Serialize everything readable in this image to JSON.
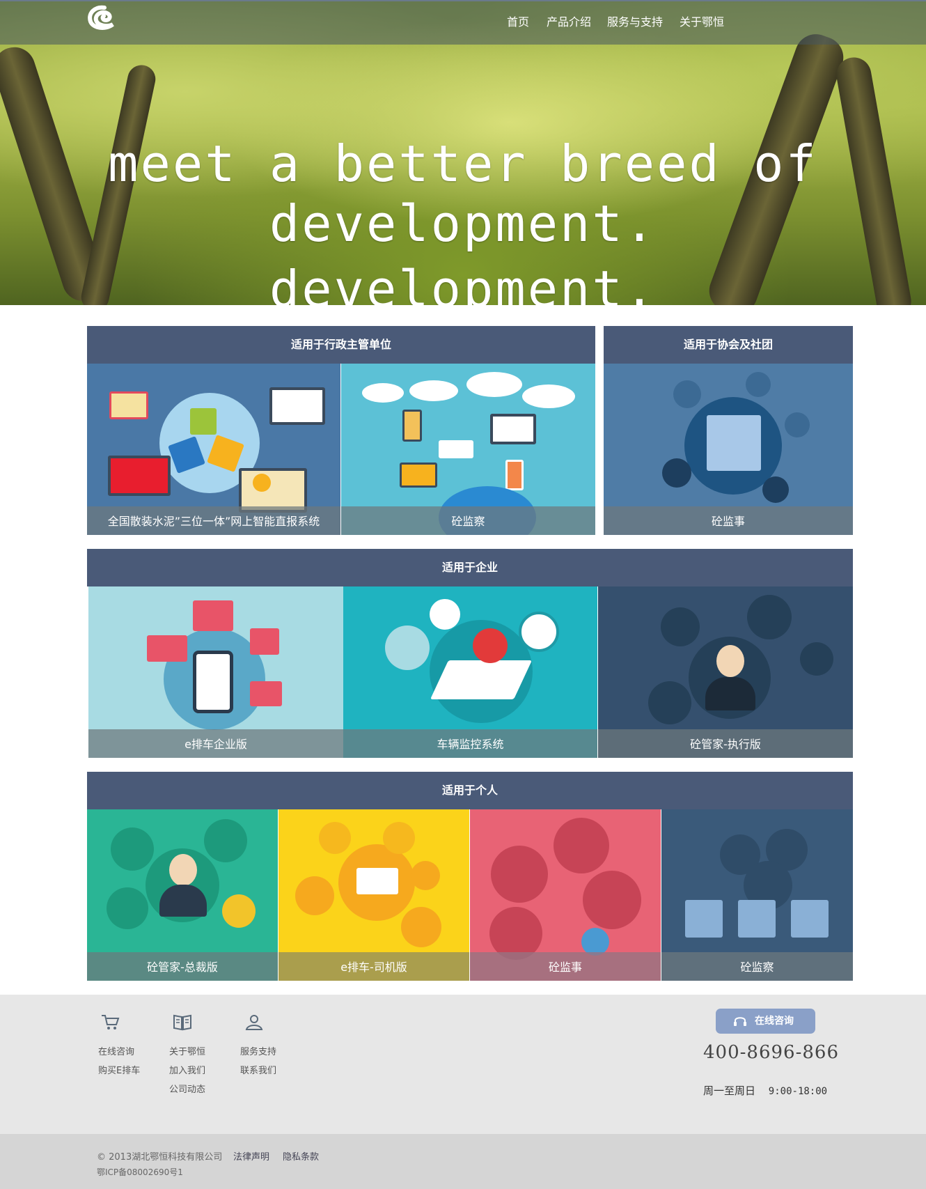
{
  "nav": {
    "home": "首页",
    "products": "产品介绍",
    "service": "服务与支持",
    "about": "关于鄂恒"
  },
  "hero": {
    "line1": "meet a better breed of",
    "line2": "development.",
    "line3": "development."
  },
  "sections": {
    "admin": {
      "title": "适用于行政主管单位"
    },
    "assoc": {
      "title": "适用于协会及社团"
    },
    "enterprise": {
      "title": "适用于企业"
    },
    "personal": {
      "title": "适用于个人"
    }
  },
  "tiles": {
    "admin_1": "全国散装水泥”三位一体”网上智能直报系统",
    "admin_2": "砼监察",
    "assoc_1": "砼监事",
    "ent_1": "e排车企业版",
    "ent_2": "车辆监控系统",
    "ent_3": "砼管家-执行版",
    "per_1": "砼管家-总裁版",
    "per_2": "e排车-司机版",
    "per_3": "砼监事",
    "per_4": "砼监察"
  },
  "footer": {
    "col1": [
      "在线咨询",
      "购买E排车"
    ],
    "col2": [
      "关于鄂恒",
      "加入我们",
      "公司动态"
    ],
    "col3": [
      "服务支持",
      "联系我们"
    ],
    "consult_label": "在线咨询",
    "phone": "400-8696-866",
    "hours_days": "周一至周日",
    "hours_time": "9:00-18:00",
    "copyright": "© 2013湖北鄂恒科技有限公司",
    "legal": "法律声明",
    "privacy": "隐私条款",
    "icp": "鄂ICP备08002690号1"
  },
  "icons": {
    "logo": "e-swirl-logo",
    "col1": "cart-icon",
    "col2": "book-icon",
    "col3": "user-icon",
    "consult": "headset-icon"
  },
  "colors": {
    "header_bar": "#4a5a78",
    "ent_tile_1": "#a8dbe3",
    "ent_tile_2": "#1fb3c0",
    "ent_tile_3": "#35506e",
    "per_tile_1": "#2ab595",
    "per_tile_2": "#fbd31a",
    "per_tile_3": "#e86375",
    "per_tile_4": "#3a5a7a"
  }
}
